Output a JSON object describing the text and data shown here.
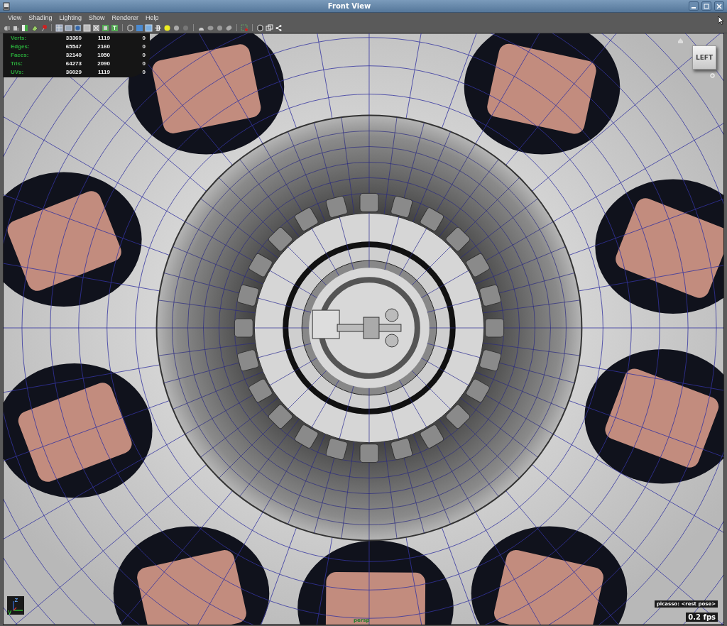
{
  "window": {
    "title": "Front View"
  },
  "menu": [
    "View",
    "Shading",
    "Lighting",
    "Show",
    "Renderer",
    "Help"
  ],
  "hud": {
    "stats": [
      {
        "label": "Verts:",
        "values": [
          "33360",
          "1119",
          "0"
        ]
      },
      {
        "label": "Edges:",
        "values": [
          "65547",
          "2160",
          "0"
        ]
      },
      {
        "label": "Faces:",
        "values": [
          "32140",
          "1050",
          "0"
        ]
      },
      {
        "label": "Tris:",
        "values": [
          "64273",
          "2090",
          "0"
        ]
      },
      {
        "label": "UVs:",
        "values": [
          "36029",
          "1119",
          "0"
        ]
      }
    ],
    "view_cube": "LEFT",
    "axis_labels": [
      "z",
      "y"
    ],
    "camera": "persp",
    "character": "picasso: <rest pose>",
    "fps": "0.2 fps"
  }
}
